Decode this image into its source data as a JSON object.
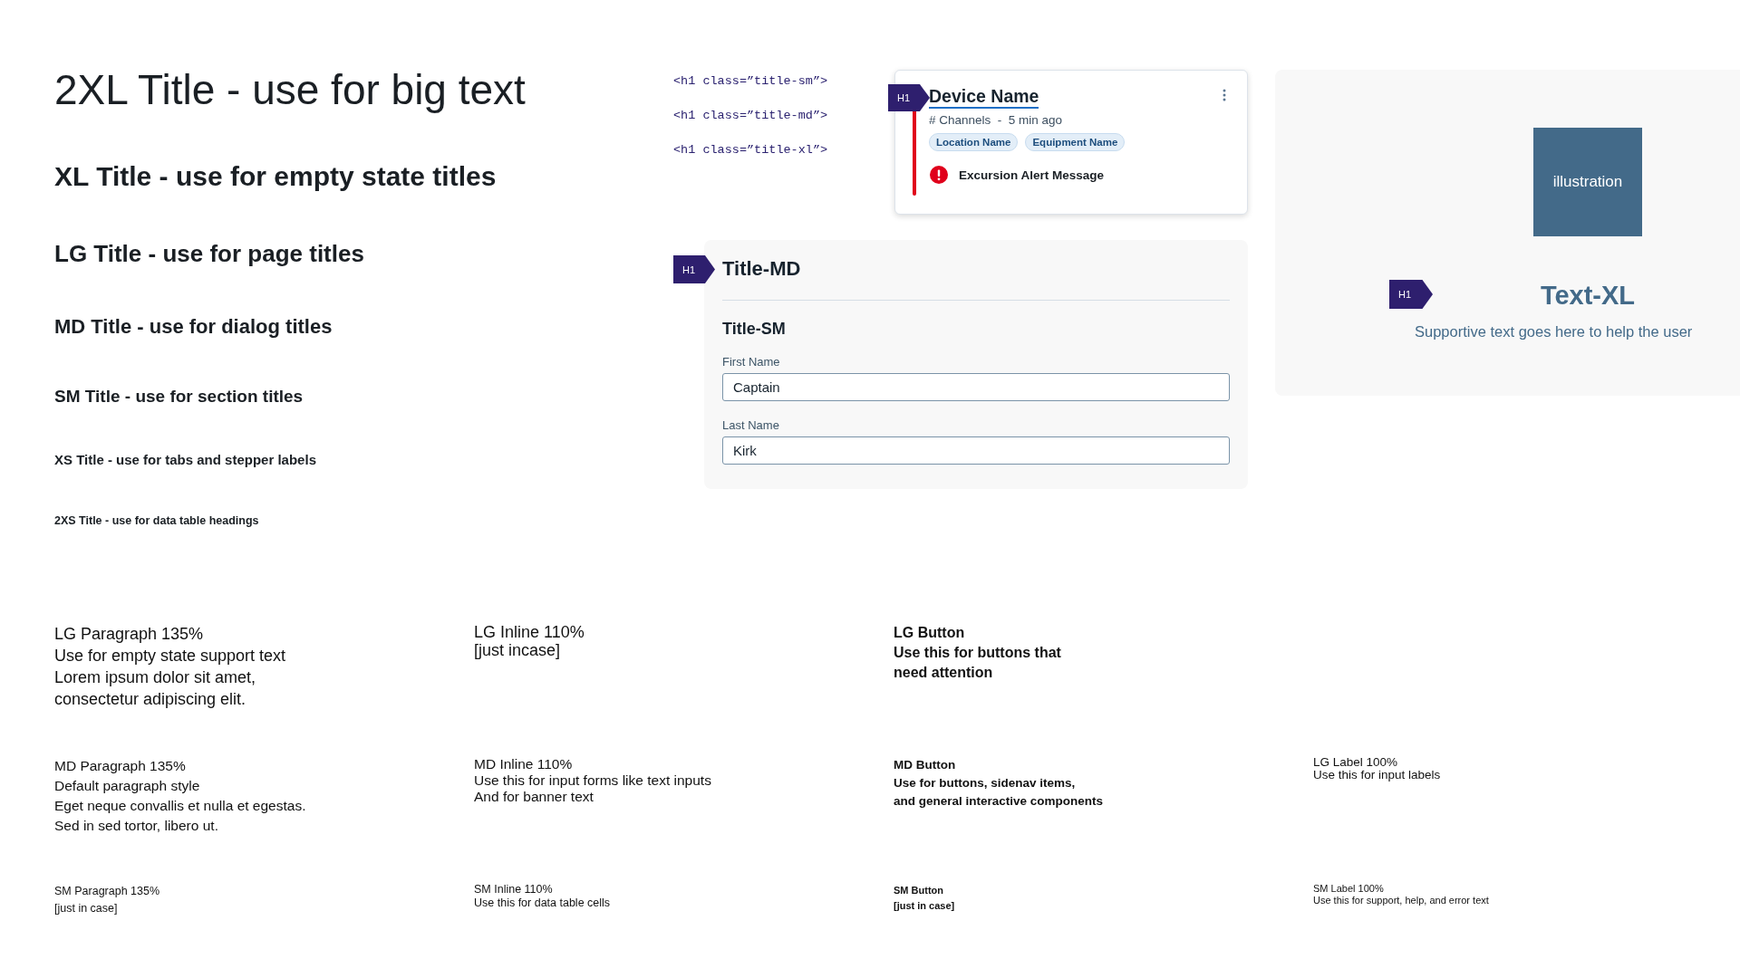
{
  "titles": [
    {
      "kind": "xxl",
      "text": "2XL Title - use for big text"
    },
    {
      "kind": "xl",
      "text": "XL Title - use for empty state titles"
    },
    {
      "kind": "lg",
      "text": "LG Title - use for page titles"
    },
    {
      "kind": "md",
      "text": "MD Title - use for dialog titles"
    },
    {
      "kind": "sm",
      "text": "SM Title - use for section titles"
    },
    {
      "kind": "xs",
      "text": "XS Title - use for tabs and stepper labels"
    },
    {
      "kind": "xxs",
      "text": "2XS Title - use for data table headings"
    }
  ],
  "code_snippets": [
    "<h1 class=”title-sm”>",
    "<h1 class=”title-md”>",
    "<h1 class=”title-xl”>"
  ],
  "device_card": {
    "tag": "H1",
    "title": "Device Name",
    "meta": "# Channels  -  5 min ago",
    "chips": [
      "Location Name",
      "Equipment Name"
    ],
    "alert": "Excursion Alert Message"
  },
  "form_panel": {
    "tag": "H1",
    "title": "Title-MD",
    "subtitle": "Title-SM",
    "fields": [
      {
        "label": "First Name",
        "value": "Captain"
      },
      {
        "label": "Last Name",
        "value": "Kirk"
      }
    ]
  },
  "empty_state": {
    "tag": "H1",
    "illustration": "illustration",
    "title": "Text-XL",
    "text": "Supportive text goes here to help the user"
  },
  "sample_rows": [
    {
      "items": [
        {
          "kind": "lg-paragraph",
          "lines": [
            "LG Paragraph 135%",
            "Use for empty state support text",
            "Lorem ipsum dolor sit amet,",
            "consectetur adipiscing elit."
          ]
        },
        {
          "kind": "lg-inline",
          "lines": [
            "LG Inline 110%",
            "[just incase]"
          ]
        },
        {
          "kind": "lg-button",
          "lines": [
            "LG Button",
            "Use this for buttons that",
            "need attention"
          ]
        }
      ]
    },
    {
      "items": [
        {
          "kind": "md-paragraph",
          "lines": [
            "MD Paragraph 135%",
            "Default paragraph style",
            "Eget neque convallis et nulla et egestas.",
            "Sed in sed tortor, libero ut."
          ]
        },
        {
          "kind": "md-inline",
          "lines": [
            "MD Inline 110%",
            "Use this for input forms like text inputs",
            "And for banner text"
          ]
        },
        {
          "kind": "md-button",
          "lines": [
            "MD Button",
            "Use for buttons, sidenav items,",
            "and general interactive components"
          ]
        },
        {
          "kind": "lg-label",
          "lines": [
            "LG Label 100%",
            "Use this for input labels"
          ]
        }
      ]
    },
    {
      "items": [
        {
          "kind": "sm-paragraph",
          "lines": [
            "SM Paragraph 135%",
            "[just in case]"
          ]
        },
        {
          "kind": "sm-inline",
          "lines": [
            "SM Inline 110%",
            "Use this for data table cells"
          ]
        },
        {
          "kind": "sm-button",
          "lines": [
            "SM Button",
            "[just in case]"
          ]
        },
        {
          "kind": "sm-label",
          "lines": [
            "SM Label 100%",
            "Use this for support, help, and error text"
          ]
        }
      ]
    }
  ]
}
